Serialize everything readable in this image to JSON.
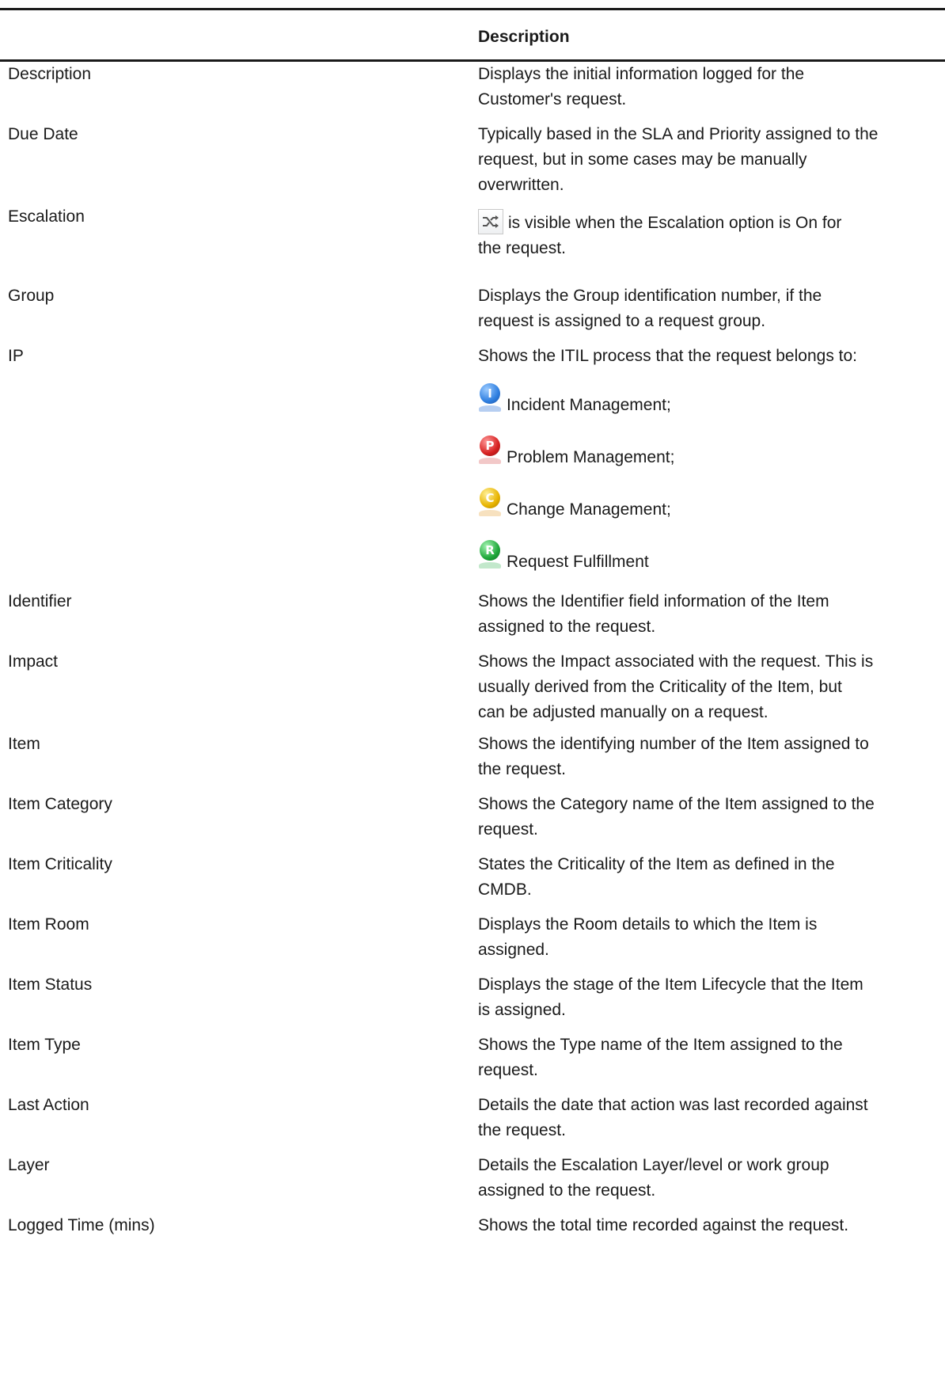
{
  "table": {
    "header": {
      "field": "",
      "description": "Description"
    },
    "rows": [
      {
        "field": "Description",
        "description": [
          "Displays the initial information logged for the",
          "Customer's request."
        ]
      },
      {
        "field": "Due Date",
        "description": [
          "Typically based in the SLA and Priority assigned to the",
          "request, but in some cases may be manually",
          "overwritten."
        ]
      },
      {
        "field": "Escalation",
        "description_suffix": [
          "is visible when the Escalation option is On for",
          "the request."
        ],
        "icon": "escalation-shuffle-icon"
      },
      {
        "field": "Group",
        "description": [
          "Displays the Group identification number, if the",
          "request is assigned to a request group."
        ]
      },
      {
        "field": "IP",
        "description": [
          "Shows the ITIL process that the request belongs to:"
        ],
        "processes": [
          {
            "label": "Incident Management;",
            "letter": "I",
            "color": "#2f7fe0",
            "icon": "incident-management-icon"
          },
          {
            "label": "Problem Management;",
            "letter": "P",
            "color": "#d62020",
            "icon": "problem-management-icon"
          },
          {
            "label": "Change Management;",
            "letter": "C",
            "color": "#e8b400",
            "icon": "change-management-icon"
          },
          {
            "label": "Request Fulfillment",
            "letter": "R",
            "color": "#1fa83a",
            "icon": "request-fulfillment-icon"
          }
        ]
      },
      {
        "field": "Identifier",
        "description": [
          "Shows the Identifier field information of the Item",
          "assigned to the request."
        ]
      },
      {
        "field": "Impact",
        "description": [
          "Shows the Impact associated with the request. This is",
          "usually derived from the Criticality of the Item, but",
          "can be adjusted manually on a request."
        ]
      },
      {
        "field": "Item",
        "description": [
          "Shows the identifying number of the Item assigned to",
          "the request."
        ]
      },
      {
        "field": "Item Category",
        "description": [
          "Shows the Category name of the Item assigned to the",
          "request."
        ]
      },
      {
        "field": "Item Criticality",
        "description": [
          "States the Criticality of the Item as defined in the",
          "CMDB."
        ]
      },
      {
        "field": "Item Room",
        "description": [
          "Displays the Room details to which the Item is",
          "assigned."
        ]
      },
      {
        "field": "Item Status",
        "description": [
          "Displays the stage of the Item Lifecycle that the Item",
          "is assigned."
        ]
      },
      {
        "field": "Item Type",
        "description": [
          "Shows the Type name of the Item assigned to the",
          "request."
        ]
      },
      {
        "field": "Last Action",
        "description": [
          "Details the date that action was last recorded against",
          "the request."
        ]
      },
      {
        "field": "Layer",
        "description": [
          "Details the Escalation Layer/level or work group",
          "assigned to the request."
        ]
      },
      {
        "field": "Logged Time (mins)",
        "description": [
          "Shows the total time recorded against the request."
        ]
      }
    ]
  }
}
